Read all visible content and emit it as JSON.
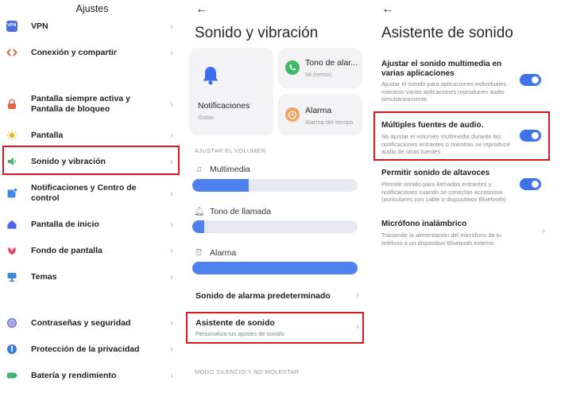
{
  "ajustes": {
    "title": "Ajustes",
    "items": [
      {
        "label": "VPN",
        "icon": "vpn-icon"
      },
      {
        "label": "Conexión y compartir",
        "icon": "share-connection-icon"
      },
      {
        "label": "Pantalla siempre activa y Pantalla de bloqueo",
        "icon": "lock-icon"
      },
      {
        "label": "Pantalla",
        "icon": "brightness-icon"
      },
      {
        "label": "Sonido y vibración",
        "icon": "speaker-icon"
      },
      {
        "label": "Notificaciones y Centro de control",
        "icon": "notification-icon"
      },
      {
        "label": "Pantalla de inicio",
        "icon": "home-icon"
      },
      {
        "label": "Fondo de pantalla",
        "icon": "wallpaper-flower-icon"
      },
      {
        "label": "Temas",
        "icon": "themes-icon"
      },
      {
        "label": "Contraseñas y seguridad",
        "icon": "fingerprint-icon"
      },
      {
        "label": "Protección de la privacidad",
        "icon": "privacy-icon"
      },
      {
        "label": "Batería y rendimiento",
        "icon": "battery-icon"
      }
    ],
    "vpn_badge": "VPN"
  },
  "sonido": {
    "title": "Sonido y vibración",
    "cards": {
      "notificaciones": {
        "title": "Notificaciones",
        "sub": "Gotas"
      },
      "tono": {
        "title": "Tono de alar...",
        "sub": "Mi (remix)"
      },
      "alarma": {
        "title": "Alarma",
        "sub": "Alarma del tiempo"
      }
    },
    "volume_section": "AJUSTAR EL VOLUMEN",
    "volumes": [
      {
        "label": "Multimedia",
        "level": 0.34
      },
      {
        "label": "Tono de llamada",
        "level": 0.07
      },
      {
        "label": "Alarma",
        "level": 1.0
      }
    ],
    "alarm_default": "Sonido de alarma predeterminado",
    "asistente": {
      "title": "Asistente de sonido",
      "sub": "Personaliza tus ajustes de sonido"
    },
    "mode_section": "MODO SILENCIO Y NO MOLESTAR"
  },
  "asistente": {
    "title": "Asistente de sonido",
    "options": [
      {
        "title": "Ajustar el sonido multimedia en varias aplicaciones",
        "desc": "Ajustar el sonido para aplicaciones individuales mientras varias aplicaciones reproducen audio simultáneamente",
        "toggle": true
      },
      {
        "title": "Múltiples fuentes de audio.",
        "desc": "No ajustar el volumen multimedia durante las notificaciones entrantes o mientras se reproduce audio de otras fuentes",
        "toggle": true
      },
      {
        "title": "Permitir sonido de altavoces",
        "desc": "Permitir sonido para llamadas entrantes y notificaciones cuando se conectan accesorios (auriculares con cable o dispositivos Bluetooth)",
        "toggle": true
      },
      {
        "title": "Micrófono inalámbrico",
        "desc": "Transmite la alimentación del micrófono de tu teléfono a un dispositivo Bluetooth externo",
        "toggle": false
      }
    ]
  },
  "colors": {
    "accent": "#4f81ef",
    "highlight": "#d71920",
    "card_bg": "#f3f3f5"
  }
}
